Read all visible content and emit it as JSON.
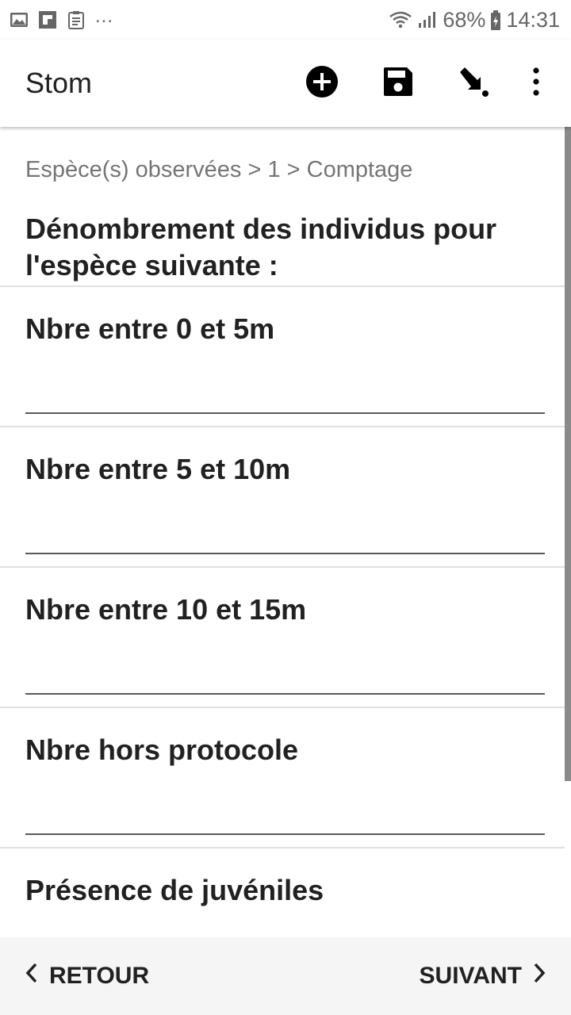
{
  "status_bar": {
    "battery": "68%",
    "time": "14:31",
    "overflow": "...",
    "icons": [
      "image-icon",
      "flipboard-icon",
      "clipboard-icon",
      "wifi-icon",
      "signal-icon",
      "battery-icon"
    ]
  },
  "app_bar": {
    "title": "Stom",
    "actions": [
      "add-circle-icon",
      "save-icon",
      "arrow-down-right-icon",
      "more-vert-icon"
    ]
  },
  "form": {
    "breadcrumb": "Espèce(s) observées > 1 > Comptage",
    "intro": "Dénombrement des individus pour l'espèce suivante :",
    "fields": [
      {
        "label": "Nbre entre 0 et 5m",
        "value": ""
      },
      {
        "label": "Nbre entre 5 et 10m",
        "value": ""
      },
      {
        "label": "Nbre entre 10 et 15m",
        "value": ""
      },
      {
        "label": "Nbre hors protocole",
        "value": ""
      },
      {
        "label": "Présence de juvéniles"
      }
    ]
  },
  "bottom_bar": {
    "back_label": "RETOUR",
    "next_label": "SUIVANT"
  },
  "colors": {
    "text_primary": "#212121",
    "text_secondary": "#757575",
    "bottom_bar_bg": "#f5f5f5",
    "scrollbar": "#8a8a8a"
  }
}
